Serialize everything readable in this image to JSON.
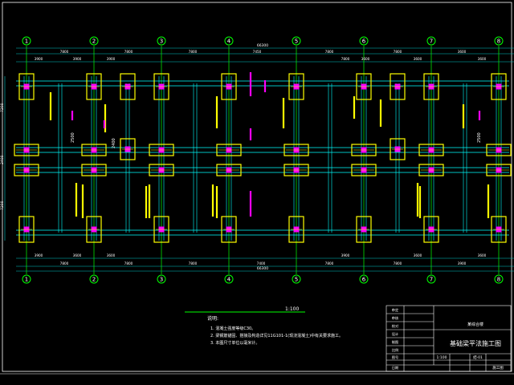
{
  "drawing": {
    "colors": {
      "background": "#000000",
      "grid_axis": "#00ff00",
      "beam": "#00ffff",
      "dimension": "#00c8c8",
      "column_box": "#ffff00",
      "column_core": "#ff00ff",
      "rebar_text": "#ffff00",
      "beam_text": "#ff00ff",
      "frame": "#ffffff",
      "title_block": "#ffffff"
    },
    "axes": [
      "1",
      "2",
      "3",
      "4",
      "5",
      "6",
      "7",
      "8"
    ],
    "top_dims": [
      "7800",
      "7800",
      "7800",
      "7450",
      "7800",
      "7800",
      "3600",
      "7800",
      "3600",
      "3900",
      "3900",
      "3900",
      "3600",
      "3600"
    ],
    "top_total": "66300",
    "bottom_dims": [
      "7800",
      "7800",
      "7800",
      "7400",
      "7800",
      "7800",
      "3900",
      "3900",
      "3600",
      "3600",
      "3900",
      "3600",
      "3600"
    ],
    "bottom_total": "66300",
    "left_dims": [
      "7200",
      "2400",
      "7200"
    ],
    "small_dim_labels": [
      "2500",
      "2400",
      "2500"
    ],
    "notes_title": "说明:",
    "notes": [
      "1. 混凝土强度等级C30。",
      "2. 梁钢筋锚固、搭接及构造详见11G101-1(现浇混凝土)中有关要求施工。",
      "3. 本图尺寸单位以毫米计。"
    ],
    "scale_label": "1:100",
    "title_block": {
      "project": "某综合楼",
      "drawing_title": "基础梁平法施工图",
      "labels": [
        "审定",
        "审核",
        "校对",
        "设计",
        "制图",
        "比例",
        "图号",
        "日期"
      ],
      "scale": "1:100",
      "sheet_no": "结-01",
      "stage": "施工图"
    }
  }
}
